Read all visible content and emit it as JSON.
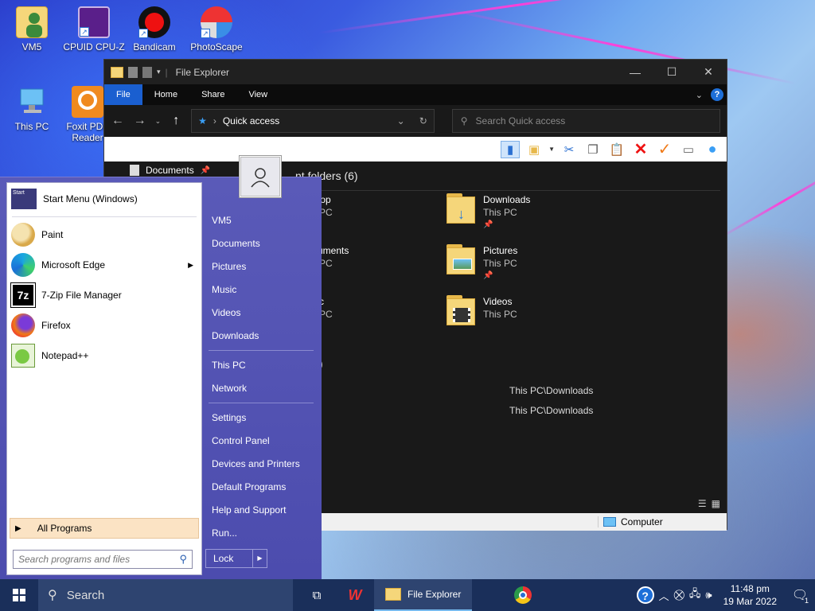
{
  "desktop": {
    "icons": [
      {
        "label": "VM5",
        "icon": "user-folder-icon"
      },
      {
        "label": "CPUID CPU-Z",
        "icon": "cpu-z-icon"
      },
      {
        "label": "Bandicam",
        "icon": "bandicam-icon"
      },
      {
        "label": "PhotoScape",
        "icon": "photoscape-icon"
      },
      {
        "label": "This PC",
        "icon": "this-pc-icon"
      },
      {
        "label": "Foxit PDF Reader",
        "icon": "foxit-icon"
      }
    ]
  },
  "explorer": {
    "title": "File Explorer",
    "tabs": [
      "File",
      "Home",
      "Share",
      "View"
    ],
    "address": "Quick access",
    "search_placeholder": "Search Quick access",
    "nav_item": "Documents",
    "frequent_header": "Frequent folders (6)",
    "frequent_header_visible": "nt folders (6)",
    "folders": [
      {
        "name": "Desktop",
        "visible_name": "top",
        "location": "This PC",
        "visible_location": "PC"
      },
      {
        "name": "Downloads",
        "location": "This PC"
      },
      {
        "name": "Documents",
        "visible_name": "uments",
        "location": "This PC",
        "visible_location": "PC"
      },
      {
        "name": "Pictures",
        "location": "This PC"
      },
      {
        "name": "Music",
        "visible_name": "c",
        "location": "This PC",
        "visible_location": "PC"
      },
      {
        "name": "Videos",
        "location": "This PC"
      }
    ],
    "recent_header_visible": ")",
    "recent_paths": [
      "This PC\\Downloads",
      "This PC\\Downloads"
    ],
    "status_location": "Computer"
  },
  "start_menu": {
    "pinned": [
      {
        "label": "Start Menu (Windows)",
        "icon": "start-menu-icon"
      }
    ],
    "programs": [
      {
        "label": "Paint",
        "icon": "paint-icon"
      },
      {
        "label": "Microsoft Edge",
        "icon": "edge-icon",
        "submenu": true
      },
      {
        "label": "7-Zip File Manager",
        "icon": "7zip-icon"
      },
      {
        "label": "Firefox",
        "icon": "firefox-icon"
      },
      {
        "label": "Notepad++",
        "icon": "notepad-plus-plus-icon"
      }
    ],
    "all_programs": "All Programs",
    "search_placeholder": "Search programs and files",
    "right_group1": [
      "VM5",
      "Documents",
      "Pictures",
      "Music",
      "Videos",
      "Downloads"
    ],
    "right_group2": [
      "This PC",
      "Network"
    ],
    "right_group3": [
      "Settings",
      "Control Panel",
      "Devices and Printers",
      "Default Programs",
      "Help and Support",
      "Run..."
    ],
    "lock_label": "Lock"
  },
  "taskbar": {
    "search_label": "Search",
    "explorer_label": "File Explorer",
    "time": "11:48 pm",
    "date": "19 Mar 2022",
    "notification_count": "1"
  }
}
